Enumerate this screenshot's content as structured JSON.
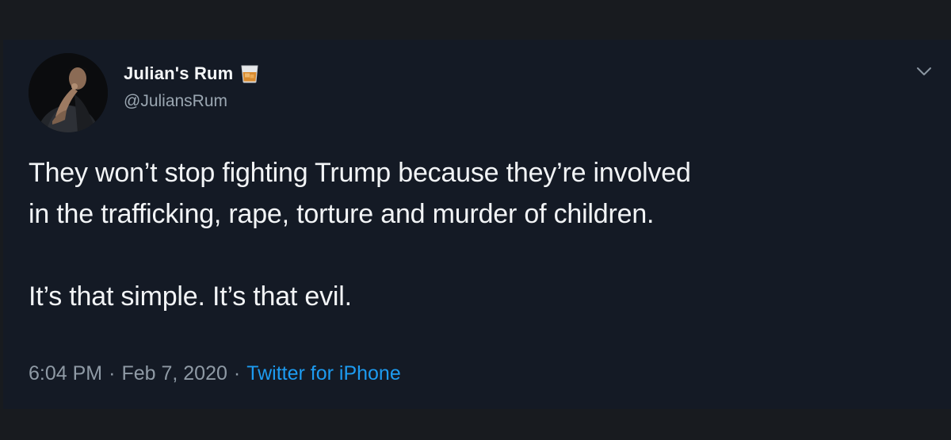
{
  "tweet": {
    "display_name": "Julian's Rum",
    "display_name_emoji": "tumbler-glass-icon",
    "handle": "@JuliansRum",
    "text_line_1": "They won’t stop fighting Trump because they’re involved",
    "text_line_2": "in the trafficking, rape, torture and murder of children.",
    "text_line_3": "It’s that simple. It’s that evil.",
    "time": "6:04 PM",
    "separator": "·",
    "date": "Feb 7, 2020",
    "source": "Twitter for iPhone"
  },
  "colors": {
    "background": "#141a25",
    "text": "#f2f4f6",
    "secondary_text": "#9aa6b1",
    "link": "#1d9bf0"
  }
}
